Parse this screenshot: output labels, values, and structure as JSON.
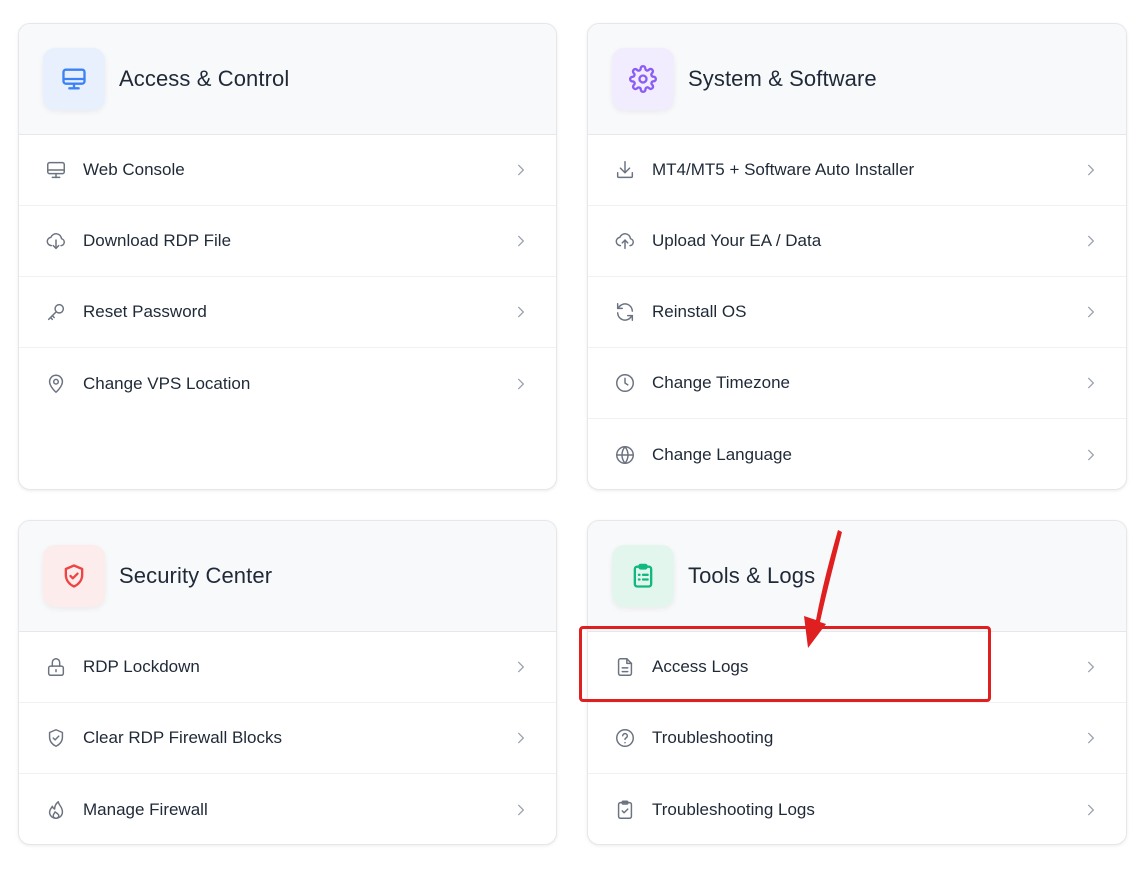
{
  "colors": {
    "blue_accent": "#3b82f6",
    "blue_bg": "#e8f0fe",
    "purple_accent": "#8b5cf6",
    "purple_bg": "#f1ecfe",
    "red_accent": "#ef4444",
    "red_bg": "#fdecec",
    "green_accent": "#10b981",
    "green_bg": "#e3f6ee",
    "annotation": "#e02020"
  },
  "cards": {
    "access": {
      "title": "Access & Control",
      "icon": "monitor-icon",
      "items": [
        {
          "label": "Web Console",
          "icon": "monitor-icon"
        },
        {
          "label": "Download RDP File",
          "icon": "cloud-download-icon"
        },
        {
          "label": "Reset Password",
          "icon": "key-icon"
        },
        {
          "label": "Change VPS Location",
          "icon": "map-pin-icon"
        }
      ]
    },
    "system": {
      "title": "System & Software",
      "icon": "gear-icon",
      "items": [
        {
          "label": "MT4/MT5 + Software Auto Installer",
          "icon": "download-icon"
        },
        {
          "label": "Upload Your EA / Data",
          "icon": "cloud-upload-icon"
        },
        {
          "label": "Reinstall OS",
          "icon": "refresh-icon"
        },
        {
          "label": "Change Timezone",
          "icon": "clock-icon"
        },
        {
          "label": "Change Language",
          "icon": "globe-icon"
        }
      ]
    },
    "security": {
      "title": "Security Center",
      "icon": "shield-check-icon",
      "items": [
        {
          "label": "RDP Lockdown",
          "icon": "lock-icon"
        },
        {
          "label": "Clear RDP Firewall Blocks",
          "icon": "shield-check-icon"
        },
        {
          "label": "Manage Firewall",
          "icon": "flame-icon"
        }
      ]
    },
    "tools": {
      "title": "Tools & Logs",
      "icon": "clipboard-list-icon",
      "items": [
        {
          "label": "Access Logs",
          "icon": "file-text-icon"
        },
        {
          "label": "Troubleshooting",
          "icon": "help-circle-icon"
        },
        {
          "label": "Troubleshooting Logs",
          "icon": "clipboard-check-icon"
        }
      ]
    }
  }
}
